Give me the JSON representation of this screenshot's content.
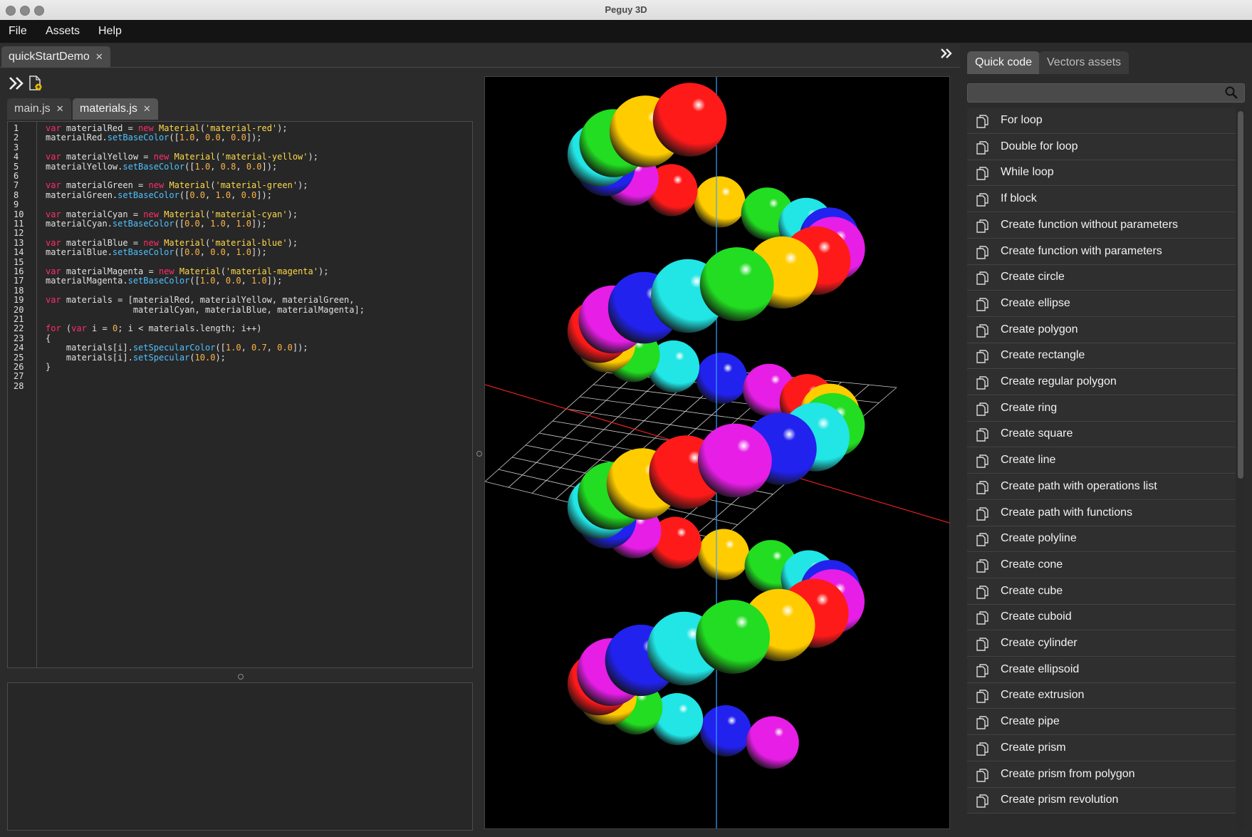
{
  "window": {
    "title": "Peguy 3D"
  },
  "menubar": {
    "items": [
      "File",
      "Assets",
      "Help"
    ]
  },
  "document_tab": {
    "label": "quickStartDemo"
  },
  "file_tabs": [
    {
      "label": "main.js"
    },
    {
      "label": "materials.js"
    }
  ],
  "code_lines": [
    "var materialRed = new Material('material-red');",
    "materialRed.setBaseColor([1.0, 0.0, 0.0]);",
    "",
    "var materialYellow = new Material('material-yellow');",
    "materialYellow.setBaseColor([1.0, 0.8, 0.0]);",
    "",
    "var materialGreen = new Material('material-green');",
    "materialGreen.setBaseColor([0.0, 1.0, 0.0]);",
    "",
    "var materialCyan = new Material('material-cyan');",
    "materialCyan.setBaseColor([0.0, 1.0, 1.0]);",
    "",
    "var materialBlue = new Material('material-blue');",
    "materialBlue.setBaseColor([0.0, 0.0, 1.0]);",
    "",
    "var materialMagenta = new Material('material-magenta');",
    "materialMagenta.setBaseColor([1.0, 0.0, 1.0]);",
    "",
    "var materials = [materialRed, materialYellow, materialGreen,",
    "                 materialCyan, materialBlue, materialMagenta];",
    "",
    "for (var i = 0; i < materials.length; i++)",
    "{",
    "    materials[i].setSpecularColor([1.0, 0.7, 0.0]);",
    "    materials[i].setSpecular(10.0);",
    "}",
    "",
    ""
  ],
  "right_panel": {
    "tabs": [
      "Quick code",
      "Vectors assets"
    ],
    "search_placeholder": "",
    "items": [
      "For loop",
      "Double for loop",
      "While loop",
      "If block",
      "Create function without parameters",
      "Create function with parameters",
      "Create circle",
      "Create ellipse",
      "Create polygon",
      "Create rectangle",
      "Create regular polygon",
      "Create ring",
      "Create square",
      "Create line",
      "Create path with operations list",
      "Create path with functions",
      "Create polyline",
      "Create cone",
      "Create cube",
      "Create cuboid",
      "Create cylinder",
      "Create ellipsoid",
      "Create extrusion",
      "Create pipe",
      "Create prism",
      "Create prism from polygon",
      "Create prism revolution"
    ]
  },
  "icons": {
    "expand": "double-chevron-right-icon",
    "new_file": "new-file-icon",
    "copy": "copy-icon",
    "search": "magnifier-icon"
  },
  "colors": {
    "sphere_red": "#ff1a1a",
    "sphere_yellow": "#ffcc00",
    "sphere_green": "#22dd22",
    "sphere_cyan": "#22e5e5",
    "sphere_blue": "#2222ee",
    "sphere_magenta": "#e61ee6",
    "axis_x": "#e02020",
    "axis_y": "#3aa0ff",
    "grid": "#cfcfcf"
  }
}
